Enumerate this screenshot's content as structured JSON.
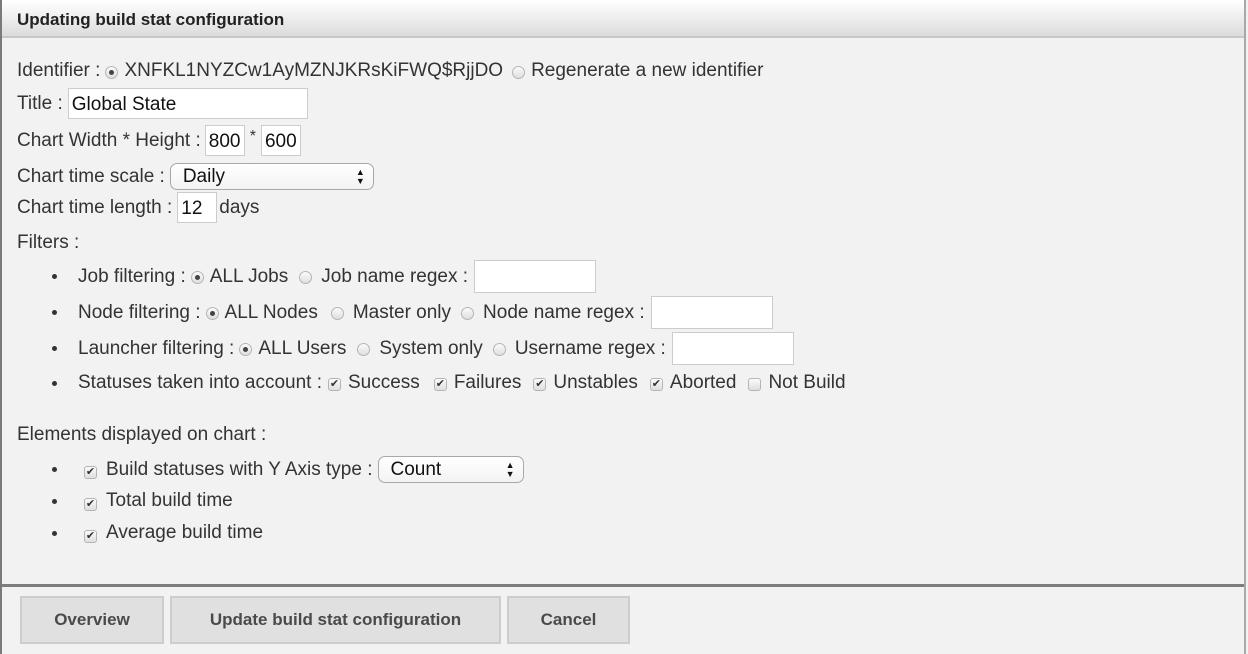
{
  "dialog": {
    "title": "Updating build stat configuration"
  },
  "identifier": {
    "label": "Identifier :",
    "current_value": "XNFKL1NYZCw1AyMZNJKRsKiFWQ$RjjDO",
    "current_selected": true,
    "regenerate_label": "Regenerate a new identifier",
    "regenerate_selected": false
  },
  "title": {
    "label": "Title :",
    "value": "Global State"
  },
  "chart_size": {
    "label": "Chart Width * Height :",
    "width": "800",
    "separator": "*",
    "height": "600"
  },
  "time_scale": {
    "label": "Chart time scale :",
    "value": "Daily",
    "arrow_icon": "updown-arrows-icon"
  },
  "time_length": {
    "label": "Chart time length :",
    "value": "12",
    "unit": "days"
  },
  "filters": {
    "label": "Filters :",
    "job": {
      "label": "Job filtering :",
      "options": [
        "ALL Jobs",
        "Job name regex :"
      ],
      "selected": 0,
      "regex_value": ""
    },
    "node": {
      "label": "Node filtering :",
      "options": [
        "ALL Nodes",
        "Master only",
        "Node name regex :"
      ],
      "selected": 0,
      "regex_value": ""
    },
    "launcher": {
      "label": "Launcher filtering :",
      "options": [
        "ALL Users",
        "System only",
        "Username regex :"
      ],
      "selected": 0,
      "regex_value": ""
    },
    "statuses": {
      "label": "Statuses taken into account :",
      "items": [
        {
          "label": "Success",
          "checked": true
        },
        {
          "label": "Failures",
          "checked": true
        },
        {
          "label": "Unstables",
          "checked": true
        },
        {
          "label": "Aborted",
          "checked": true
        },
        {
          "label": "Not Build",
          "checked": false
        }
      ]
    }
  },
  "elements": {
    "label": "Elements displayed on chart :",
    "build_statuses": {
      "label": "Build statuses with Y Axis type :",
      "checked": true,
      "y_axis_type": "Count"
    },
    "total_build_time": {
      "label": "Total build time",
      "checked": true
    },
    "average_build_time": {
      "label": "Average build time",
      "checked": true
    }
  },
  "buttons": {
    "overview": "Overview",
    "update": "Update build stat configuration",
    "cancel": "Cancel"
  },
  "glyphs": {
    "check": "✔",
    "arrows": "▲▼"
  }
}
